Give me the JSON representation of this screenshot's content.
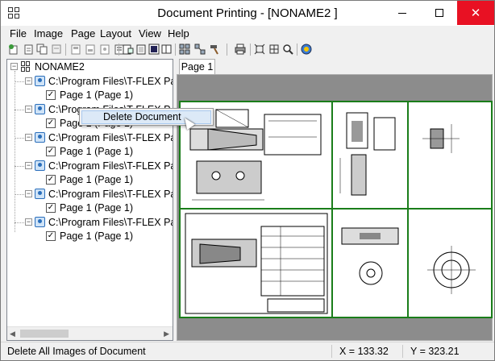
{
  "window": {
    "title": "Document Printing - [NONAME2 ]",
    "close_glyph": "✕"
  },
  "menu": [
    "File",
    "Image",
    "Page",
    "Layout",
    "View",
    "Help"
  ],
  "toolbar_icons": [
    "new-page-icon",
    "add-page-icon",
    "duplicate-icon",
    "copy-icon",
    "properties-icon",
    "add-document-icon",
    "page-setup-icon",
    "page-layout-icon",
    "page-arrange-icon",
    "fit-icon",
    "fit-page-icon",
    "auto-layout-icon",
    "print-icon",
    "fit-width-icon",
    "fit-all-icon",
    "zoom-icon",
    "run-icon"
  ],
  "tree": {
    "root": "NONAME2",
    "documents": [
      {
        "path": "C:\\Program Files\\T-FLEX Parar",
        "page": "Page 1 (Page 1)"
      },
      {
        "path": "C:\\Program Files\\T-FLEX P",
        "page": "Page 1 (Page 1)"
      },
      {
        "path": "C:\\Program Files\\T-FLEX Parar",
        "page": "Page 1 (Page 1)"
      },
      {
        "path": "C:\\Program Files\\T-FLEX Parar",
        "page": "Page 1 (Page 1)"
      },
      {
        "path": "C:\\Program Files\\T-FLEX Parar",
        "page": "Page 1 (Page 1)"
      },
      {
        "path": "C:\\Program Files\\T-FLEX Parar",
        "page": "Page 1 (Page 1)"
      }
    ],
    "expander_glyph": "−",
    "check_glyph": "✓"
  },
  "context_menu": {
    "item": "Delete Document"
  },
  "tabs": [
    "Page 1"
  ],
  "status": {
    "message": "Delete All Images of Document",
    "x": "X = 133.32",
    "y": "Y = 323.21"
  },
  "colors": {
    "page_border": "#1a7d1a",
    "close_button": "#e81123",
    "menu_highlight": "#dce9f7"
  }
}
